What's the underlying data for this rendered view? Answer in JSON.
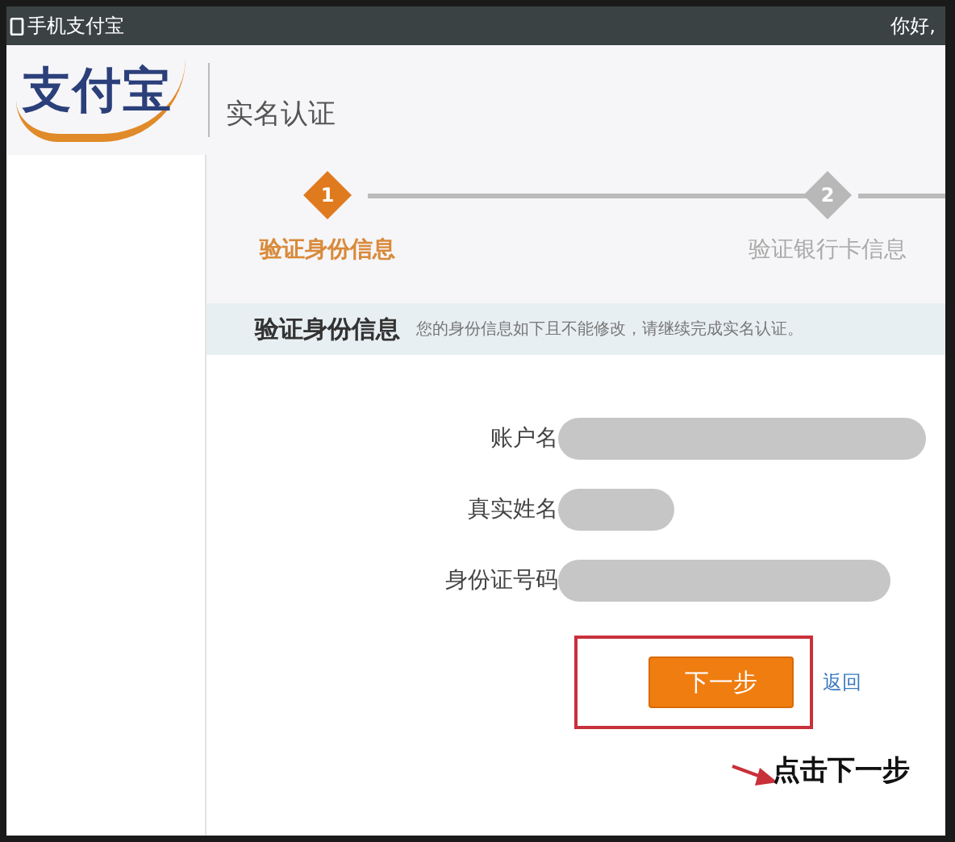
{
  "top_bar": {
    "title": "手机支付宝",
    "greeting": "你好,"
  },
  "header": {
    "logo": "支付宝",
    "page_title": "实名认证"
  },
  "steps": [
    {
      "number": "1",
      "label": "验证身份信息",
      "selected": true
    },
    {
      "number": "2",
      "label": "验证银行卡信息",
      "selected": false
    }
  ],
  "section": {
    "title": "验证身份信息",
    "note": "您的身份信息如下且不能修改，请继续完成实名认证。"
  },
  "fields": [
    {
      "label": "账户名",
      "kind": "long"
    },
    {
      "label": "真实姓名",
      "kind": "short"
    },
    {
      "label": "身份证号码",
      "kind": "medium"
    }
  ],
  "actions": {
    "next": "下一步",
    "back": "返回"
  },
  "annotation": {
    "caption": "点击下一步"
  }
}
